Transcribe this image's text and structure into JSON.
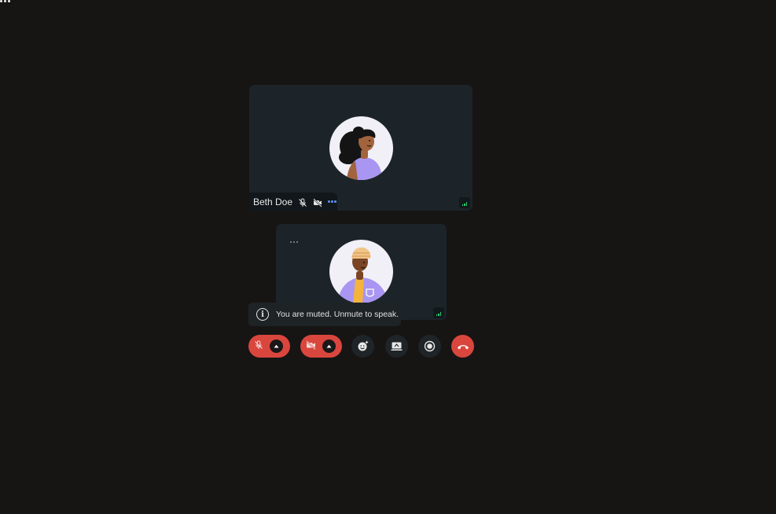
{
  "participants": {
    "main": {
      "name": "Beth Doe",
      "mic": "muted",
      "camera": "off"
    },
    "self": {
      "mic": "muted",
      "camera": "off"
    }
  },
  "toast": {
    "message": "You are muted. Unmute to speak."
  },
  "controls": [
    {
      "id": "mic",
      "icon": "mic-off-icon",
      "state": "muted",
      "color": "#d9463d"
    },
    {
      "id": "camera",
      "icon": "video-off-icon",
      "state": "off",
      "color": "#d9463d"
    },
    {
      "id": "reactions",
      "icon": "emoji-add-icon"
    },
    {
      "id": "share-screen",
      "icon": "screen-share-icon"
    },
    {
      "id": "record",
      "icon": "record-icon"
    },
    {
      "id": "leave",
      "icon": "phone-hangup-icon",
      "color": "#d9463d"
    }
  ],
  "colors": {
    "background": "#171414",
    "tile": "#1c2429",
    "accent_red": "#d9463d",
    "signal": "#2ecc71",
    "menu_blue": "#5b8df7"
  }
}
